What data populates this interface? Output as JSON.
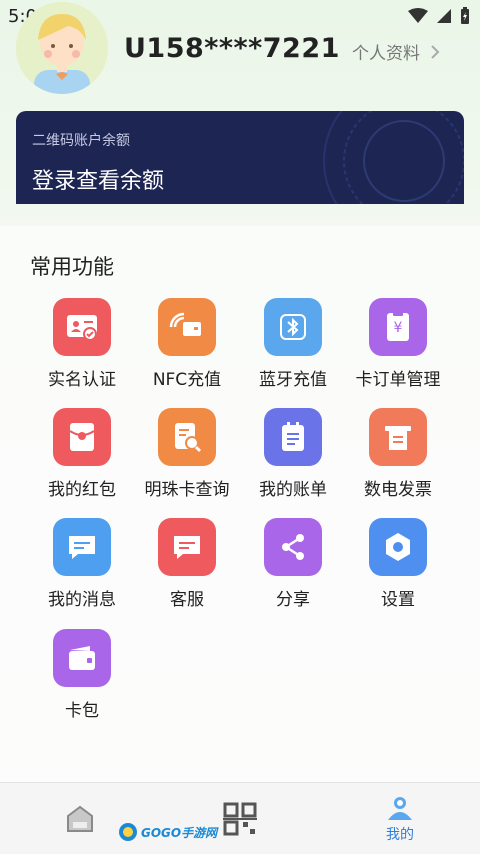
{
  "status_bar": {
    "time": "5:08",
    "indicator": "A"
  },
  "header": {
    "user_id": "U158****7221",
    "profile_link": "个人资料"
  },
  "balance_card": {
    "label": "二维码账户余额",
    "value": "登录查看余额"
  },
  "functions": {
    "title": "常用功能",
    "items": [
      {
        "label": "实名认证",
        "icon": "id-card-icon",
        "color": "#ee5a5e"
      },
      {
        "label": "NFC充值",
        "icon": "nfc-card-icon",
        "color": "#f08a45"
      },
      {
        "label": "蓝牙充值",
        "icon": "bluetooth-icon",
        "color": "#5aa7ee"
      },
      {
        "label": "卡订单管理",
        "icon": "order-icon",
        "color": "#a966e8"
      },
      {
        "label": "我的红包",
        "icon": "red-packet-icon",
        "color": "#ee5a5e"
      },
      {
        "label": "明珠卡查询",
        "icon": "card-search-icon",
        "color": "#f08a45"
      },
      {
        "label": "我的账单",
        "icon": "bill-icon",
        "color": "#6a73e8"
      },
      {
        "label": "数电发票",
        "icon": "invoice-icon",
        "color": "#f07a5a"
      },
      {
        "label": "我的消息",
        "icon": "message-icon",
        "color": "#4f9ff0"
      },
      {
        "label": "客服",
        "icon": "customer-service-icon",
        "color": "#ee5a5e"
      },
      {
        "label": "分享",
        "icon": "share-icon",
        "color": "#a966e8"
      },
      {
        "label": "设置",
        "icon": "settings-icon",
        "color": "#4f8ff0"
      },
      {
        "label": "卡包",
        "icon": "wallet-icon",
        "color": "#a966e8"
      }
    ]
  },
  "bottom_nav": {
    "home_icon": "home-icon",
    "scan_icon": "qr-code-icon",
    "mine_label": "我的",
    "watermark": "GOGO手游网"
  },
  "colors": {
    "card_bg": "#1d2553",
    "accent_blue": "#2f7fd8"
  }
}
